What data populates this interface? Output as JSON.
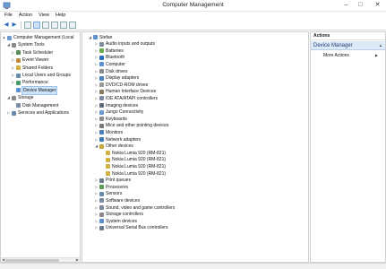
{
  "window": {
    "title": "Computer Management",
    "minimize": "–",
    "maximize": "□",
    "close": "✕"
  },
  "menu": [
    "File",
    "Action",
    "View",
    "Help"
  ],
  "toolbar": {
    "back": "◀",
    "forward": "▶"
  },
  "left_tree": [
    {
      "label": "Computer Management (Local",
      "icon": "computer-management-icon",
      "indent": 0,
      "expander": "▲"
    },
    {
      "label": "System Tools",
      "icon": "system-tools-icon",
      "indent": 1,
      "expander": "◢"
    },
    {
      "label": "Task Scheduler",
      "icon": "task-scheduler-icon",
      "indent": 2,
      "expander": "▷"
    },
    {
      "label": "Event Viewer",
      "icon": "event-viewer-icon",
      "indent": 2,
      "expander": "▷"
    },
    {
      "label": "Shared Folders",
      "icon": "shared-folders-icon",
      "indent": 2,
      "expander": "▷"
    },
    {
      "label": "Local Users and Groups",
      "icon": "users-icon",
      "indent": 2,
      "expander": "▷"
    },
    {
      "label": "Performance",
      "icon": "performance-icon",
      "indent": 2,
      "expander": "▷"
    },
    {
      "label": "Device Manager",
      "icon": "device-manager-icon",
      "indent": 2,
      "expander": "",
      "selected": true
    },
    {
      "label": "Storage",
      "icon": "storage-icon",
      "indent": 1,
      "expander": "◢"
    },
    {
      "label": "Disk Management",
      "icon": "disk-management-icon",
      "indent": 2,
      "expander": ""
    },
    {
      "label": "Services and Applications",
      "icon": "services-icon",
      "indent": 1,
      "expander": "▷"
    }
  ],
  "device_tree": [
    {
      "label": "Stefan",
      "icon": "computer-icon",
      "indent": 0,
      "expander": "◢",
      "color": "#5b8fd1"
    },
    {
      "label": "Audio inputs and outputs",
      "icon": "speaker-icon",
      "indent": 1,
      "expander": "▷",
      "color": "#7a8a99"
    },
    {
      "label": "Batteries",
      "icon": "battery-icon",
      "indent": 1,
      "expander": "▷",
      "color": "#6aa84f"
    },
    {
      "label": "Bluetooth",
      "icon": "bluetooth-icon",
      "indent": 1,
      "expander": "▷",
      "color": "#2b6cc4"
    },
    {
      "label": "Computer",
      "icon": "computer-icon",
      "indent": 1,
      "expander": "▷",
      "color": "#5b8fd1"
    },
    {
      "label": "Disk drives",
      "icon": "disk-icon",
      "indent": 1,
      "expander": "▷",
      "color": "#8a8a8a"
    },
    {
      "label": "Display adapters",
      "icon": "display-icon",
      "indent": 1,
      "expander": "▷",
      "color": "#4a7fc0"
    },
    {
      "label": "DVD/CD-ROM drives",
      "icon": "dvd-icon",
      "indent": 1,
      "expander": "▷",
      "color": "#9a9a9a"
    },
    {
      "label": "Human Interface Devices",
      "icon": "hid-icon",
      "indent": 1,
      "expander": "▷",
      "color": "#8a7a60"
    },
    {
      "label": "IDE ATA/ATAPI controllers",
      "icon": "ide-icon",
      "indent": 1,
      "expander": "▷",
      "color": "#7a8aa0"
    },
    {
      "label": "Imaging devices",
      "icon": "camera-icon",
      "indent": 1,
      "expander": "▷",
      "color": "#5a6a7a"
    },
    {
      "label": "Jungo Connectivity",
      "icon": "jungo-icon",
      "indent": 1,
      "expander": "▷",
      "color": "#6a9ad0"
    },
    {
      "label": "Keyboards",
      "icon": "keyboard-icon",
      "indent": 1,
      "expander": "▷",
      "color": "#8a8a8a"
    },
    {
      "label": "Mice and other pointing devices",
      "icon": "mouse-icon",
      "indent": 1,
      "expander": "▷",
      "color": "#7a7a7a"
    },
    {
      "label": "Monitors",
      "icon": "monitor-icon",
      "indent": 1,
      "expander": "▷",
      "color": "#4a7fc0"
    },
    {
      "label": "Network adapters",
      "icon": "network-icon",
      "indent": 1,
      "expander": "▷",
      "color": "#3a7ab0"
    },
    {
      "label": "Other devices",
      "icon": "other-devices-icon",
      "indent": 1,
      "expander": "◢",
      "color": "#c9a83a"
    },
    {
      "label": "Nokia Lumia 920 (RM-821)",
      "icon": "warning-device-icon",
      "indent": 2,
      "expander": "",
      "color": "#d4b040"
    },
    {
      "label": "Nokia Lumia 920 (RM-821)",
      "icon": "warning-device-icon",
      "indent": 2,
      "expander": "",
      "color": "#d4b040"
    },
    {
      "label": "Nokia Lumia 920 (RM-821)",
      "icon": "warning-device-icon",
      "indent": 2,
      "expander": "",
      "color": "#d4b040"
    },
    {
      "label": "Nokia Lumia 920 (RM-821)",
      "icon": "warning-device-icon",
      "indent": 2,
      "expander": "",
      "color": "#d4b040"
    },
    {
      "label": "Print queues",
      "icon": "printer-icon",
      "indent": 1,
      "expander": "▷",
      "color": "#6a7a8a"
    },
    {
      "label": "Processors",
      "icon": "processor-icon",
      "indent": 1,
      "expander": "▷",
      "color": "#5a9a5a"
    },
    {
      "label": "Sensors",
      "icon": "sensor-icon",
      "indent": 1,
      "expander": "▷",
      "color": "#6a8aaa"
    },
    {
      "label": "Software devices",
      "icon": "software-device-icon",
      "indent": 1,
      "expander": "▷",
      "color": "#7a8aa0"
    },
    {
      "label": "Sound, video and game controllers",
      "icon": "sound-icon",
      "indent": 1,
      "expander": "▷",
      "color": "#7a8a99"
    },
    {
      "label": "Storage controllers",
      "icon": "storage-controller-icon",
      "indent": 1,
      "expander": "▷",
      "color": "#8a8a8a"
    },
    {
      "label": "System devices",
      "icon": "system-devices-icon",
      "indent": 1,
      "expander": "▷",
      "color": "#5b8fd1"
    },
    {
      "label": "Universal Serial Bus controllers",
      "icon": "usb-icon",
      "indent": 1,
      "expander": "▷",
      "color": "#6a7a8a"
    }
  ],
  "actions": {
    "header": "Actions",
    "section": "Device Manager",
    "section_caret": "▲",
    "more": "More Actions",
    "more_arrow": "▶"
  },
  "colors": {
    "selection": "#cfe3f8",
    "actions_section": "#dde9f7"
  }
}
